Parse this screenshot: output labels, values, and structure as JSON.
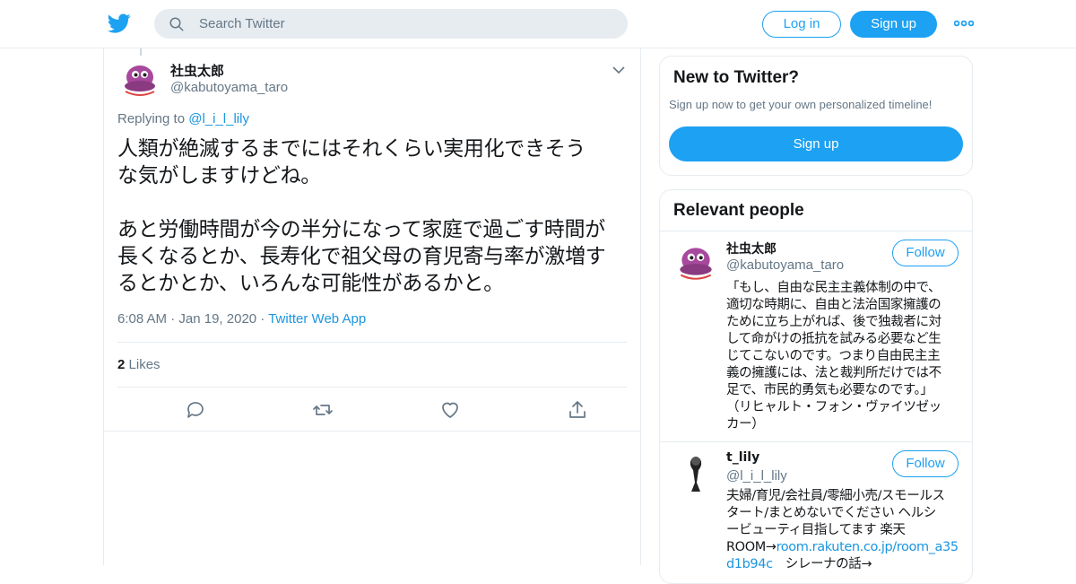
{
  "header": {
    "logo_icon": "twitter-bird-icon",
    "search_placeholder": "Search Twitter",
    "login_label": "Log in",
    "signup_label": "Sign up",
    "more_icon": "more-dots-icon",
    "accent_color": "#1da1f2"
  },
  "tweet": {
    "name": "社虫太郎",
    "handle": "@kabutoyama_taro",
    "replying_prefix": "Replying to",
    "replying_to": "@l_i_l_lily",
    "text": "人類が絶滅するまでにはそれくらい実用化できそう\nな気がしますけどね。\n\nあと労働時間が今の半分になって家庭で過ごす時間が\n長くなるとか、長寿化で祖父母の育児寄与率が激増す\nるとかとか、いろんな可能性があるかと。",
    "time": "6:08 AM",
    "date": "Jan 19, 2020",
    "app": "Twitter Web App",
    "sep": "·",
    "likes_count": "2",
    "likes_label": "Likes"
  },
  "sidebar": {
    "new_title": "New to Twitter?",
    "new_sub": "Sign up now to get your own personalized timeline!",
    "new_signup": "Sign up",
    "relevant_title": "Relevant people",
    "follow_label": "Follow",
    "people": [
      {
        "name": "社虫太郎",
        "handle": "@kabutoyama_taro",
        "bio": "「もし、自由な民主主義体制の中で、\n適切な時期に、自由と法治国家擁護の\nために立ち上がれば、後で独裁者に対\nして命がけの抵抗を試みる必要など生\nじてこないのです。つまり自由民主主\n義の擁護には、法と裁判所だけでは不\n足で、市民的勇気も必要なのです。」\n（リヒャルト・フォン・ヴァイツゼッ\nカー）"
      },
      {
        "name": "t_lily",
        "handle": "@l_i_l_lily",
        "bio_text": "夫婦/育児/会社員/零細小売/スモールス\nタート/まとめないでください ヘルシ\nービューティ目指してます 楽天\nROOM→",
        "bio_link": "room.rakuten.co.jp/room_a35\nd1b94c",
        "bio_tail": "　シレーナの話→"
      }
    ]
  }
}
